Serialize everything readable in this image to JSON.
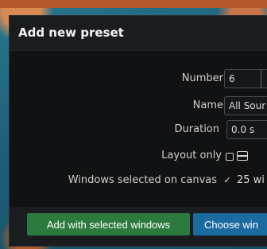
{
  "dialog": {
    "title": "Add new preset",
    "fields": {
      "number": {
        "label": "Number",
        "value": "6"
      },
      "name": {
        "label": "Name",
        "value": "All Sour"
      },
      "duration": {
        "label": "Duration",
        "value": "0.0 s"
      },
      "layout_only": {
        "label": "Layout only",
        "checked": false
      },
      "windows_selected": {
        "label": "Windows selected on canvas",
        "checked": true,
        "value": "25 wi"
      }
    },
    "buttons": {
      "add_selected": "Add with selected windows",
      "choose": "Choose win"
    }
  },
  "colors": {
    "dialog_bg": "#111214",
    "titlebar_bg": "#1b1c1f",
    "green_button": "#2d7a3e",
    "blue_button": "#1b6aa0"
  }
}
